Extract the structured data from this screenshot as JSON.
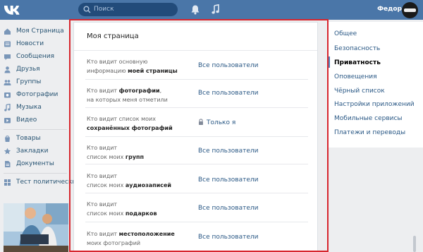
{
  "header": {
    "logo": "vk-logo",
    "search_placeholder": "Поиск",
    "user_name": "Федор"
  },
  "sidebar": {
    "items": [
      {
        "label": "Моя Страница",
        "icon": "home-icon"
      },
      {
        "label": "Новости",
        "icon": "news-icon"
      },
      {
        "label": "Сообщения",
        "icon": "messages-icon"
      },
      {
        "label": "Друзья",
        "icon": "friends-icon"
      },
      {
        "label": "Группы",
        "icon": "groups-icon"
      },
      {
        "label": "Фотографии",
        "icon": "photos-icon"
      },
      {
        "label": "Музыка",
        "icon": "music-icon"
      },
      {
        "label": "Видео",
        "icon": "video-icon"
      },
      {
        "label": "Товары",
        "icon": "goods-icon"
      },
      {
        "label": "Закладки",
        "icon": "bookmarks-icon"
      },
      {
        "label": "Документы",
        "icon": "documents-icon"
      },
      {
        "label": "Тест политических",
        "icon": "app-icon"
      }
    ]
  },
  "main": {
    "title": "Моя страница",
    "rows": [
      {
        "q1": "Кто видит основную",
        "q2_pre": "информацию ",
        "q2_bold": "моей страницы",
        "value": "Все пользователи"
      },
      {
        "q1_pre": "Кто видит ",
        "q1_bold": "фотографии",
        "q1_post": ",",
        "q2": "на которых меня отметили",
        "value": "Все пользователи"
      },
      {
        "q1": "Кто видит список моих",
        "q2_bold": "сохранённых фотографий",
        "value": "Только я",
        "value_icon": "lock-icon"
      },
      {
        "q1": "Кто видит",
        "q2_pre": "список моих ",
        "q2_bold": "групп",
        "value": "Все пользователи"
      },
      {
        "q1": "Кто видит",
        "q2_pre": "список моих ",
        "q2_bold": "аудиозаписей",
        "value": "Все пользователи"
      },
      {
        "q1": "Кто видит",
        "q2_pre": "список моих ",
        "q2_bold": "подарков",
        "value": "Все пользователи"
      },
      {
        "q1_pre": "Кто видит ",
        "q1_bold": "местоположение",
        "q2": "моих фотографий",
        "value": "Все пользователи"
      }
    ]
  },
  "settings_menu": {
    "items": [
      {
        "label": "Общее"
      },
      {
        "label": "Безопасность"
      },
      {
        "label": "Приватность",
        "active": true
      },
      {
        "label": "Оповещения"
      },
      {
        "label": "Чёрный список"
      },
      {
        "label": "Настройки приложений"
      },
      {
        "label": "Мобильные сервисы"
      },
      {
        "label": "Платежи и переводы"
      }
    ]
  },
  "colors": {
    "header": "#4a76a8",
    "link": "#2a5885",
    "highlight_frame": "#d7262e",
    "page_bg": "#edeef0"
  }
}
